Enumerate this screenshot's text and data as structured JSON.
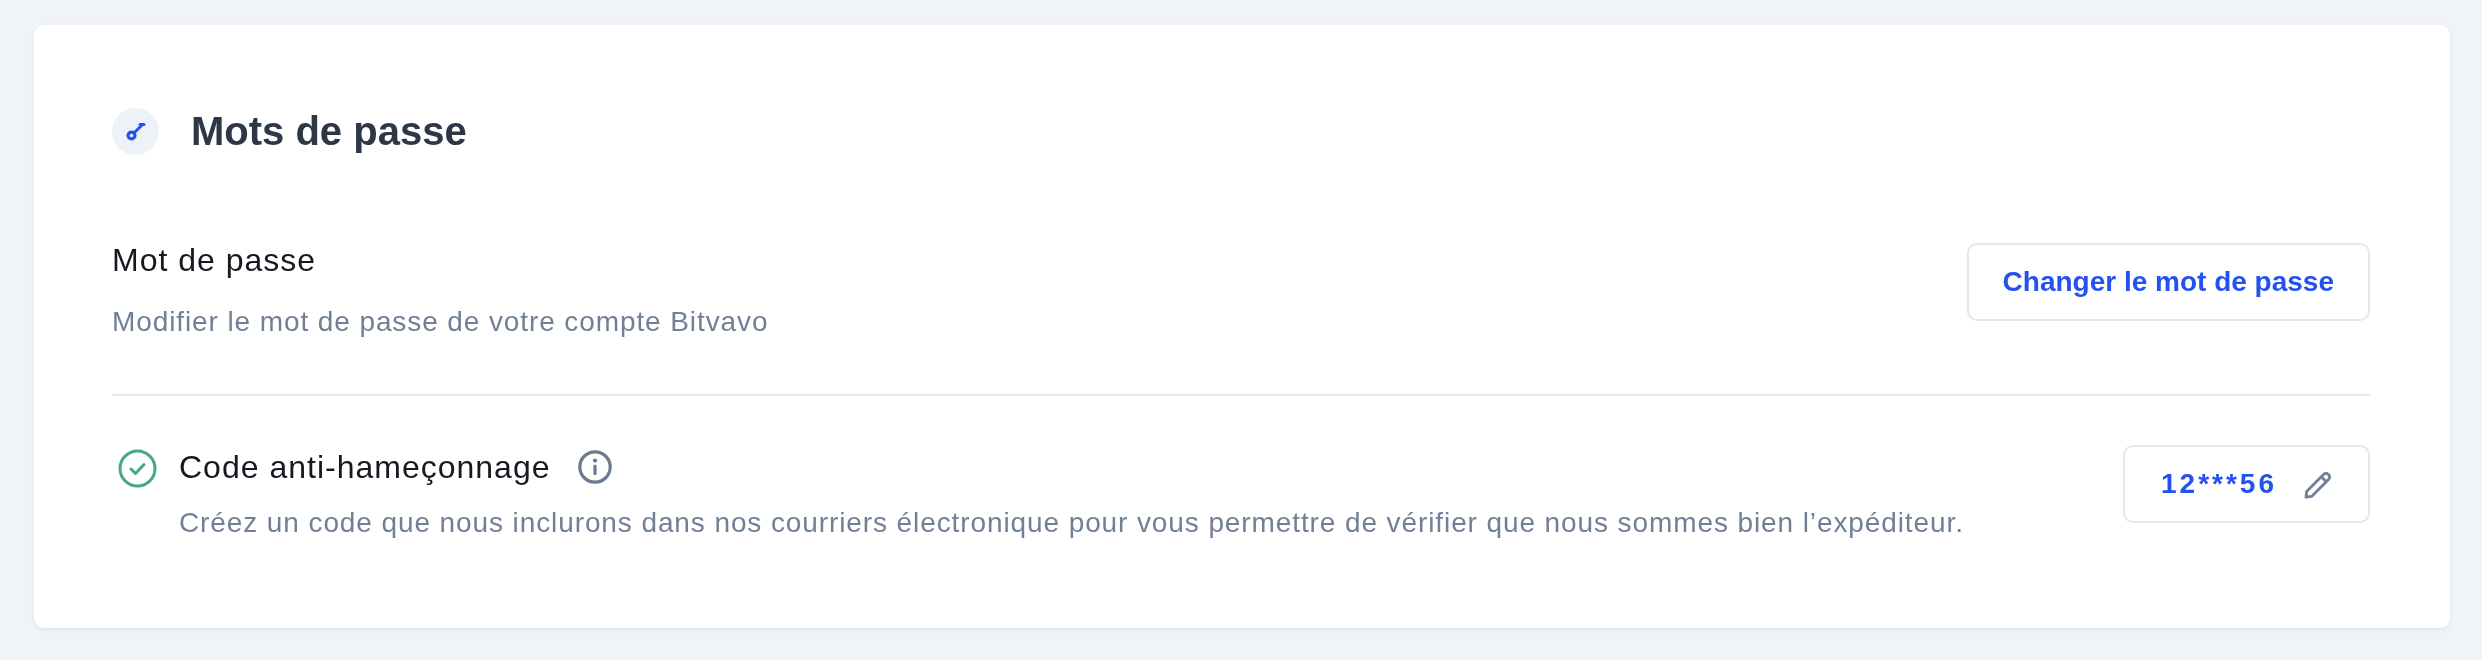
{
  "section": {
    "title": "Mots de passe"
  },
  "settings": [
    {
      "kind": "action",
      "label": "Mot de passe",
      "description": "Modifier le mot de passe de votre compte Bitvavo",
      "button": "Changer le mot de passe"
    },
    {
      "kind": "code",
      "verified": true,
      "label": "Code anti-hameçonnage",
      "description": "Créez un code que nous inclurons dans nos courriers électronique pour vous permettre de vérifier que nous sommes bien l’expéditeur.",
      "value": "12***56"
    }
  ]
}
